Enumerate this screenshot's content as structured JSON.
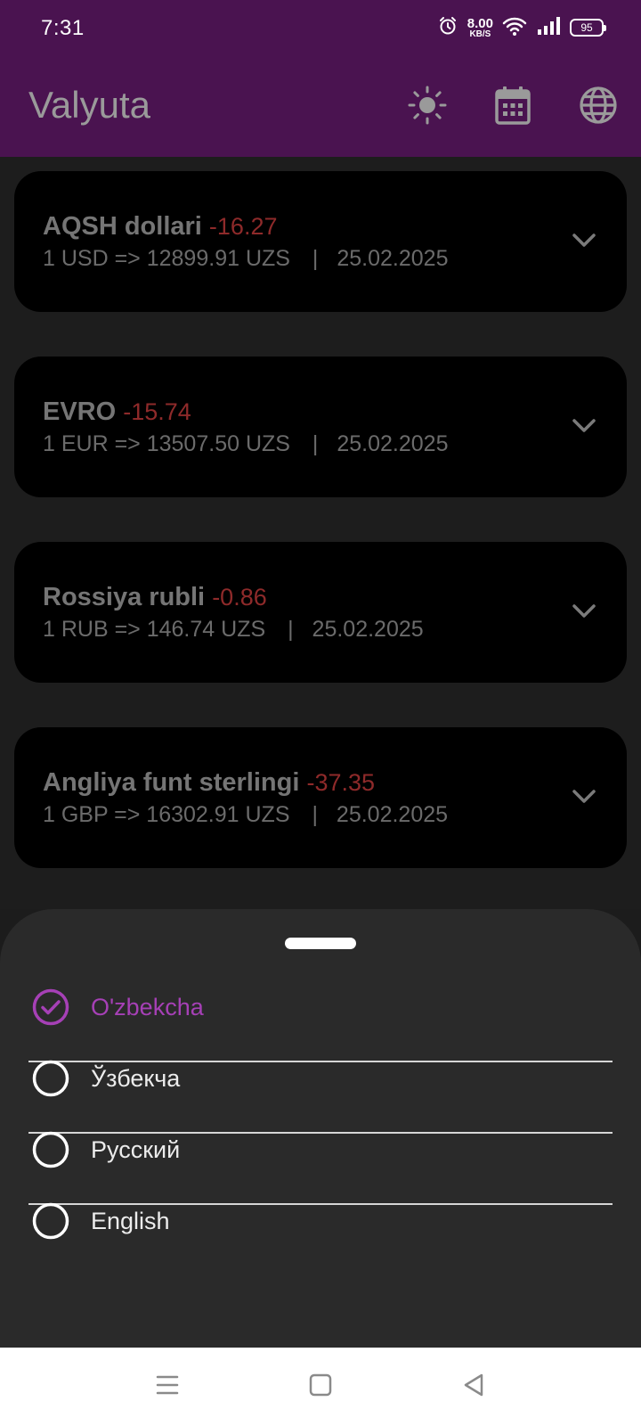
{
  "status_bar": {
    "time": "7:31",
    "net_speed_value": "8.00",
    "net_speed_unit": "KB/S",
    "battery": "95"
  },
  "app_bar": {
    "title": "Valyuta",
    "actions": [
      "theme-brightness-icon",
      "calendar-icon",
      "globe-icon"
    ]
  },
  "currencies": [
    {
      "name": "AQSH dollari",
      "diff": "-16.27",
      "rate": "1 USD => 12899.91 UZS",
      "separator": "|",
      "date": "25.02.2025"
    },
    {
      "name": "EVRO",
      "diff": "-15.74",
      "rate": "1 EUR => 13507.50 UZS",
      "separator": "|",
      "date": "25.02.2025"
    },
    {
      "name": "Rossiya rubli",
      "diff": "-0.86",
      "rate": "1 RUB => 146.74 UZS",
      "separator": "|",
      "date": "25.02.2025"
    },
    {
      "name": "Angliya funt sterlingi",
      "diff": "-37.35",
      "rate": "1 GBP => 16302.91 UZS",
      "separator": "|",
      "date": "25.02.2025"
    }
  ],
  "language_sheet": {
    "options": [
      {
        "label": "O'zbekcha",
        "selected": true
      },
      {
        "label": "Ўзбекча",
        "selected": false
      },
      {
        "label": "Русский",
        "selected": false
      },
      {
        "label": "English",
        "selected": false
      }
    ]
  },
  "colors": {
    "app_bar": "#4a1350",
    "accent": "#a640b6",
    "negative": "#8e2a2a",
    "sheet": "#2a2a2a"
  }
}
